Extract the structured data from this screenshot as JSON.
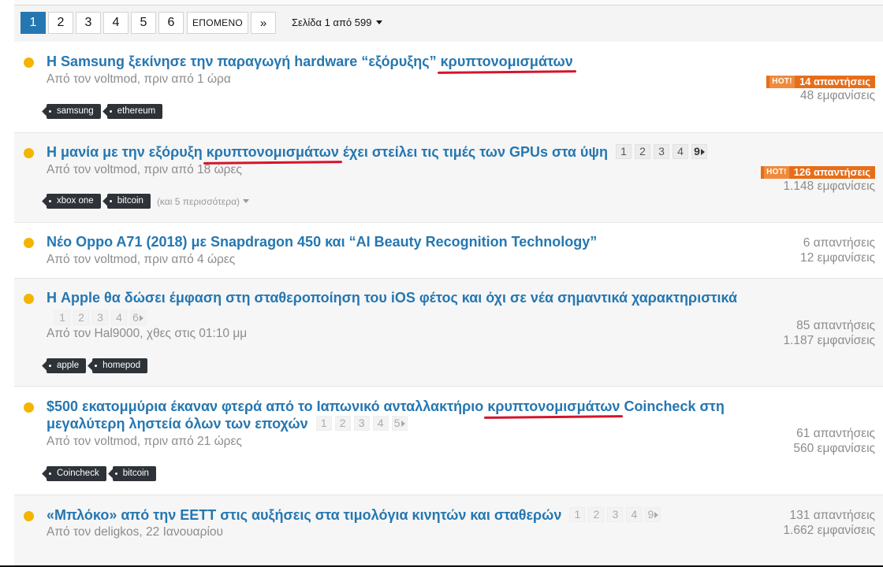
{
  "pagination": {
    "pages": [
      "1",
      "2",
      "3",
      "4",
      "5",
      "6"
    ],
    "active": "1",
    "next_label": "ΕΠΟΜΕΝΟ",
    "jump_label": "»",
    "page_of": "Σελίδα 1 από 599"
  },
  "threads": [
    {
      "title_before": "Η Samsung ξεκίνησε την παραγωγή hardware “εξόρυξης” ",
      "title_highlight": "κρυπτονομισμάτων",
      "title_after": "",
      "meta": "Από τον voltmod, πριν από 1 ώρα",
      "tags": [
        "samsung",
        "ethereum"
      ],
      "hot_label": "HOT!",
      "replies": "14 απαντήσεις",
      "views": "48 εμφανίσεις"
    },
    {
      "title_before": "Η μανία με την εξόρυξη ",
      "title_highlight": "κρυπτονομισμάτων",
      "title_after": " έχει στείλει τις τιμές των GPUs στα ύψη",
      "mini_pages": [
        "1",
        "2",
        "3",
        "4",
        "9"
      ],
      "meta": "Από τον voltmod, πριν από 18 ώρες",
      "tags": [
        "xbox one",
        "bitcoin"
      ],
      "more_tags": "(και 5 περισσότερα)",
      "hot_label": "HOT!",
      "replies": "126 απαντήσεις",
      "views": "1.148 εμφανίσεις"
    },
    {
      "title": "Νέο Oppo A71 (2018) με Snapdragon 450 και “AI Beauty Recognition Technology”",
      "meta": "Από τον voltmod, πριν από 4 ώρες",
      "replies": "6 απαντήσεις",
      "views": "12 εμφανίσεις"
    },
    {
      "title": "Η Apple θα δώσει έμφαση στη σταθεροποίηση του iOS φέτος και όχι σε νέα σημαντικά χαρακτηριστικά",
      "mini_pages": [
        "1",
        "2",
        "3",
        "4",
        "6"
      ],
      "meta": "Από τον Hal9000, χθες στις 01:10 μμ",
      "tags": [
        "apple",
        "homepod"
      ],
      "replies": "85 απαντήσεις",
      "views": "1.187 εμφανίσεις"
    },
    {
      "title_before": "$500 εκατομμύρια έκαναν φτερά από το Ιαπωνικό ανταλλακτήριο ",
      "title_highlight": "κρυπτονομισμάτων",
      "title_after": " Coincheck στη",
      "title_line2": "μεγαλύτερη ληστεία όλων των εποχών",
      "mini_pages": [
        "1",
        "2",
        "3",
        "4",
        "5"
      ],
      "meta": "Από τον voltmod, πριν από 21 ώρες",
      "tags": [
        "Coincheck",
        "bitcoin"
      ],
      "replies": "61 απαντήσεις",
      "views": "560 εμφανίσεις"
    },
    {
      "title": "«Μπλόκο» από την ΕΕΤΤ στις αυξήσεις στα τιμολόγια κινητών και σταθερών",
      "mini_pages": [
        "1",
        "2",
        "3",
        "4",
        "9"
      ],
      "meta": "Από τον deligkos, 22 Ιανουαρίου",
      "replies": "131 απαντήσεις",
      "views": "1.662 εμφανίσεις"
    }
  ],
  "colors": {
    "link": "#2577b1",
    "unread_dot": "#f4b400",
    "hot_badge": "#e66e1a",
    "tag_bg": "#2d3338",
    "highlight_underline": "#d4142b"
  },
  "icons": [
    "unread-dot-icon",
    "tag-icon",
    "caret-down-icon",
    "arrow-right-icon"
  ]
}
